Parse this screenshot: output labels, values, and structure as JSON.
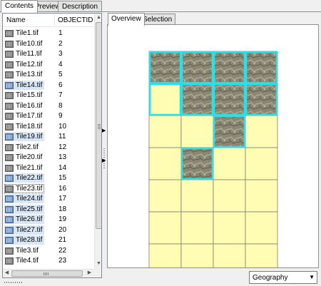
{
  "outer_tabs": [
    "Contents",
    "Preview",
    "Description"
  ],
  "list": {
    "columns": [
      "Name",
      "OBJECTID"
    ],
    "rows": [
      {
        "name": "Tile1.tif",
        "oid": "1",
        "selected": false
      },
      {
        "name": "Tile10.tif",
        "oid": "2",
        "selected": false
      },
      {
        "name": "Tile11.tif",
        "oid": "3",
        "selected": false
      },
      {
        "name": "Tile12.tif",
        "oid": "4",
        "selected": false
      },
      {
        "name": "Tile13.tif",
        "oid": "5",
        "selected": false
      },
      {
        "name": "Tile14.tif",
        "oid": "6",
        "selected": true
      },
      {
        "name": "Tile15.tif",
        "oid": "7",
        "selected": false
      },
      {
        "name": "Tile16.tif",
        "oid": "8",
        "selected": false
      },
      {
        "name": "Tile17.tif",
        "oid": "9",
        "selected": false
      },
      {
        "name": "Tile18.tif",
        "oid": "10",
        "selected": false
      },
      {
        "name": "Tile19.tif",
        "oid": "11",
        "selected": true
      },
      {
        "name": "Tile2.tif",
        "oid": "12",
        "selected": false
      },
      {
        "name": "Tile20.tif",
        "oid": "13",
        "selected": false
      },
      {
        "name": "Tile21.tif",
        "oid": "14",
        "selected": false
      },
      {
        "name": "Tile22.tif",
        "oid": "15",
        "selected": true
      },
      {
        "name": "Tile23.tif",
        "oid": "16",
        "selected": false,
        "focus": true
      },
      {
        "name": "Tile24.tif",
        "oid": "17",
        "selected": true
      },
      {
        "name": "Tile25.tif",
        "oid": "18",
        "selected": true
      },
      {
        "name": "Tile26.tif",
        "oid": "19",
        "selected": true
      },
      {
        "name": "Tile27.tif",
        "oid": "20",
        "selected": true
      },
      {
        "name": "Tile28.tif",
        "oid": "21",
        "selected": true
      },
      {
        "name": "Tile3.tif",
        "oid": "22",
        "selected": false
      },
      {
        "name": "Tile4.tif",
        "oid": "23",
        "selected": false
      }
    ]
  },
  "inner_tabs": [
    "Overview",
    "Selection"
  ],
  "overview": {
    "cols": 4,
    "rows": 7,
    "imagery_tiles": [
      [
        0,
        0
      ],
      [
        0,
        1
      ],
      [
        0,
        2
      ],
      [
        0,
        3
      ],
      [
        1,
        1
      ],
      [
        1,
        2
      ],
      [
        1,
        3
      ],
      [
        2,
        2
      ],
      [
        3,
        1
      ]
    ],
    "highlighted_tiles": [
      [
        0,
        0
      ],
      [
        0,
        1
      ],
      [
        0,
        2
      ],
      [
        0,
        3
      ],
      [
        1,
        0
      ],
      [
        1,
        1
      ],
      [
        1,
        2
      ],
      [
        1,
        3
      ],
      [
        2,
        2
      ],
      [
        3,
        1
      ]
    ],
    "colors": {
      "empty_tile": "#fffcb4",
      "highlight": "#29e0e8",
      "grid_line": "#7d7d6f",
      "imagery": "#8a8773"
    }
  },
  "view_mode": {
    "selected": "Geography"
  }
}
